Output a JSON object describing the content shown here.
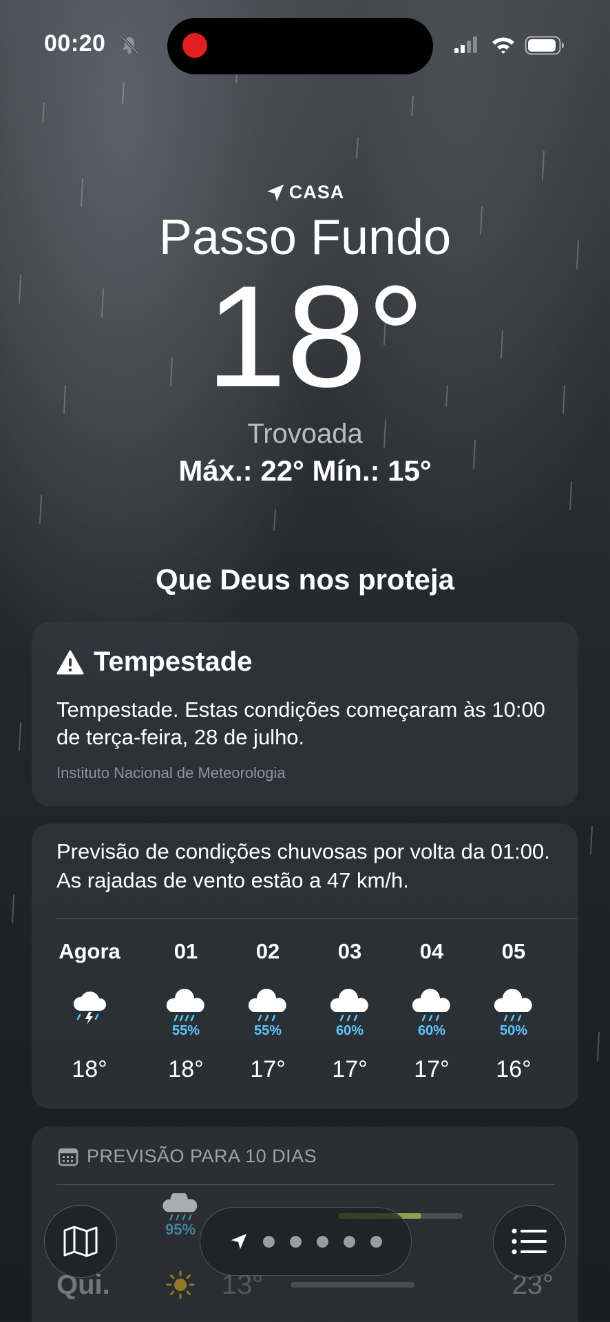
{
  "status_bar": {
    "time": "00:20",
    "icons": [
      "bell-slash-icon",
      "recording-icon",
      "cellular-signal-icon",
      "wifi-icon",
      "battery-icon"
    ]
  },
  "location": {
    "label": "CASA",
    "city": "Passo Fundo",
    "temperature": "18°",
    "condition": "Trovoada",
    "high_low": "Máx.: 22°  Mín.: 15°"
  },
  "headline": "Que Deus nos proteja",
  "alert": {
    "title": "Tempestade",
    "body": "Tempestade. Estas condições começaram às 10:00 de terça-feira, 28 de julho.",
    "source": "Instituto Nacional de Meteorologia"
  },
  "hourly": {
    "summary": "Previsão de condições chuvosas por volta da 01:00. As rajadas de vento estão a 47 km/h.",
    "hours": [
      {
        "label": "Agora",
        "icon": "thunderstorm-icon",
        "pop": "",
        "temp": "18°"
      },
      {
        "label": "01",
        "icon": "rain-cloud-icon",
        "pop": "55%",
        "temp": "18°"
      },
      {
        "label": "02",
        "icon": "rain-cloud-icon",
        "pop": "55%",
        "temp": "17°"
      },
      {
        "label": "03",
        "icon": "rain-cloud-icon",
        "pop": "60%",
        "temp": "17°"
      },
      {
        "label": "04",
        "icon": "rain-cloud-icon",
        "pop": "60%",
        "temp": "17°"
      },
      {
        "label": "05",
        "icon": "rain-cloud-icon",
        "pop": "50%",
        "temp": "16°"
      }
    ]
  },
  "ten_day": {
    "title": "PREVISÃO PARA 10 DIAS",
    "days": [
      {
        "name": "",
        "icon": "rain-cloud-icon",
        "pop": "95%",
        "low": "",
        "high": ""
      },
      {
        "name": "Qui.",
        "icon": "sun-icon",
        "pop": "",
        "low": "13°",
        "high": "23°"
      }
    ]
  },
  "toolbar": {
    "map_icon": "map-icon",
    "location_icon": "location-arrow-icon",
    "page_dots": 5,
    "list_icon": "list-icon"
  },
  "colors": {
    "precipitation": "#5ac8fa",
    "record_dot": "#e02020",
    "condition_text": "#b9bcc3"
  }
}
